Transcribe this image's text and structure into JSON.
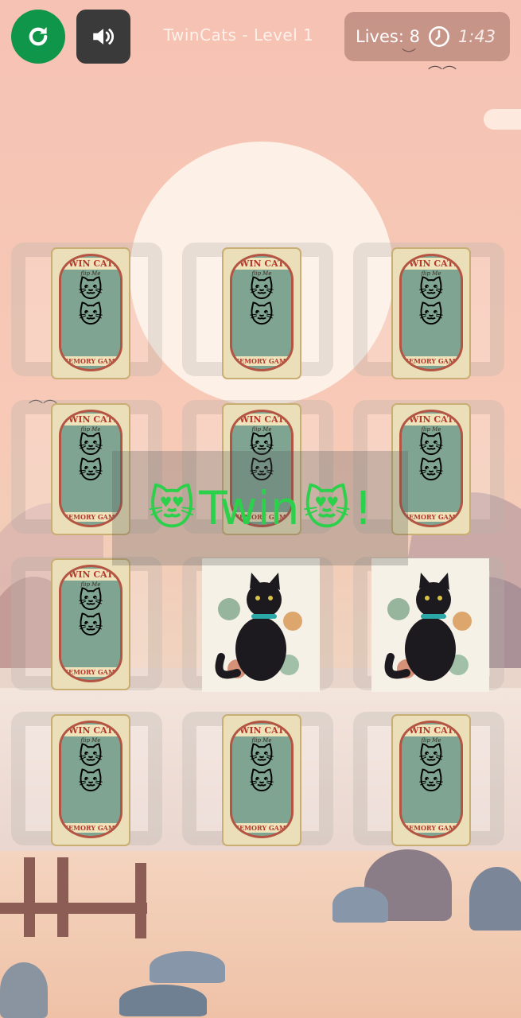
{
  "header": {
    "title": "TwinCats - Level 1",
    "lives_label": "Lives: 8",
    "timer": "1:43"
  },
  "card_back": {
    "title": "TWIN CATS",
    "subtitle": "flip Me",
    "footer": "MEMORY GAME"
  },
  "banner": {
    "text": "Twin",
    "exclaim": "!",
    "emoji": "😻"
  },
  "colors": {
    "accent_green": "#10964a",
    "banner_text": "#2bd14a"
  },
  "icons": {
    "restart": "restart-icon",
    "sound": "speaker-icon",
    "timer": "clock-icon"
  },
  "grid": {
    "rows": 4,
    "columns": 3,
    "cards": [
      {
        "state": "face-down"
      },
      {
        "state": "face-down"
      },
      {
        "state": "face-down"
      },
      {
        "state": "face-down"
      },
      {
        "state": "face-down"
      },
      {
        "state": "face-down"
      },
      {
        "state": "face-down"
      },
      {
        "state": "matched",
        "image": "black-cat"
      },
      {
        "state": "matched",
        "image": "black-cat"
      },
      {
        "state": "face-down"
      },
      {
        "state": "face-down"
      },
      {
        "state": "face-down"
      }
    ]
  }
}
